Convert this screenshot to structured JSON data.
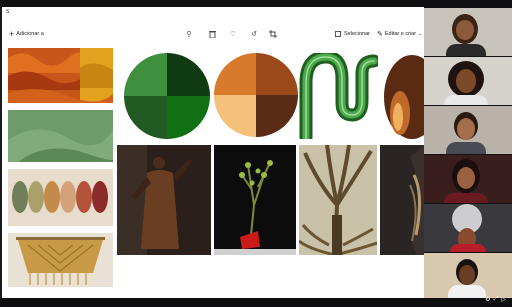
{
  "app": {
    "title_partial": "S",
    "add_label": "Adicionar a",
    "select_label": "Selecionar",
    "filter_label": "Editar e criar"
  },
  "icons": {
    "add": "plus-icon",
    "zoom": "zoom-icon",
    "trash": "trash-icon",
    "heart": "heart-icon",
    "rotate": "rotate-icon",
    "crop": "crop-icon",
    "select": "select-icon",
    "edit": "edit-icon",
    "chevron": "chevron-down-icon"
  },
  "colors": {
    "green_circle": [
      "#3f8f3f",
      "#0f3a12",
      "#215a22",
      "#127014"
    ],
    "earth_circle": [
      "#d77a2c",
      "#9c4a1c",
      "#f5c07a",
      "#5a2c16"
    ],
    "snake_green": "#3a9a3a",
    "dark_orb": "#5a2a12"
  },
  "video_participants": 6
}
